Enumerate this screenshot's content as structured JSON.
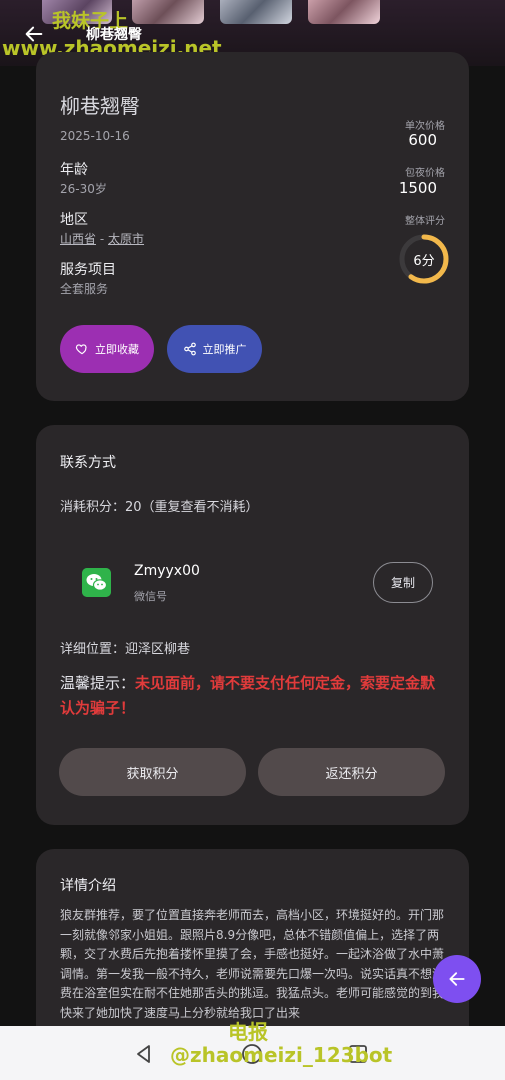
{
  "header": {
    "title": "柳巷翘臀",
    "watermark_top": "我妹子上",
    "watermark_url": "www.zhaomeizi.net"
  },
  "profile": {
    "name": "柳巷翘臀",
    "date": "2025-10-16",
    "age_label": "年龄",
    "age_value": "26-30岁",
    "region_label": "地区",
    "province": "山西省",
    "separator": "-",
    "city": "太原市",
    "service_label": "服务项目",
    "service_value": "全套服务",
    "single_price_label": "单次价格",
    "single_price": "600",
    "night_price_label": "包夜价格",
    "night_price": "1500",
    "rating_label": "整体评分",
    "rating_text": "6分",
    "rating_value": 6,
    "rating_max": 10,
    "rating_color": "#f2b84b",
    "favorite_label": "立即收藏",
    "share_label": "立即推广",
    "favorite_color": "#9c2fb2",
    "share_color": "#4152b3"
  },
  "contact": {
    "title": "联系方式",
    "cost_text": "消耗积分：20（重复查看不消耗）",
    "wechat_id": "Zmyyx00",
    "wechat_sub": "微信号",
    "copy_label": "复制",
    "location_text": "详细位置：迎泽区柳巷",
    "warning_label": "温馨提示：",
    "warning_text": "未见面前，请不要支付任何定金，索要定金默认为骗子！",
    "get_points_label": "获取积分",
    "return_points_label": "返还积分"
  },
  "details": {
    "title": "详情介绍",
    "text": "狼友群推荐，要了位置直接奔老师而去，高档小区，环境挺好的。开门那一刻就像邻家小姐姐。跟照片8.9分像吧，总体不错颜值偏上，选择了两颗，交了水费后先抱着搂怀里摸了会，手感也挺好。一起沐浴做了水中萧调情。第一发我一般不持久，老师说需要先口爆一次吗。说实话真不想浪费在浴室但实在耐不住她那舌头的挑逗。我猛点头。老师可能感觉的到我快来了她加快了速度马上分秒就给我口了出来"
  },
  "watermark_bottom": {
    "line1": "电报",
    "line2": "@zhaomeizi_123bot"
  },
  "icons": {
    "back": "arrow-left-icon",
    "heart": "heart-icon",
    "share": "share-icon",
    "wechat": "wechat-icon",
    "fab": "arrow-left-icon"
  }
}
